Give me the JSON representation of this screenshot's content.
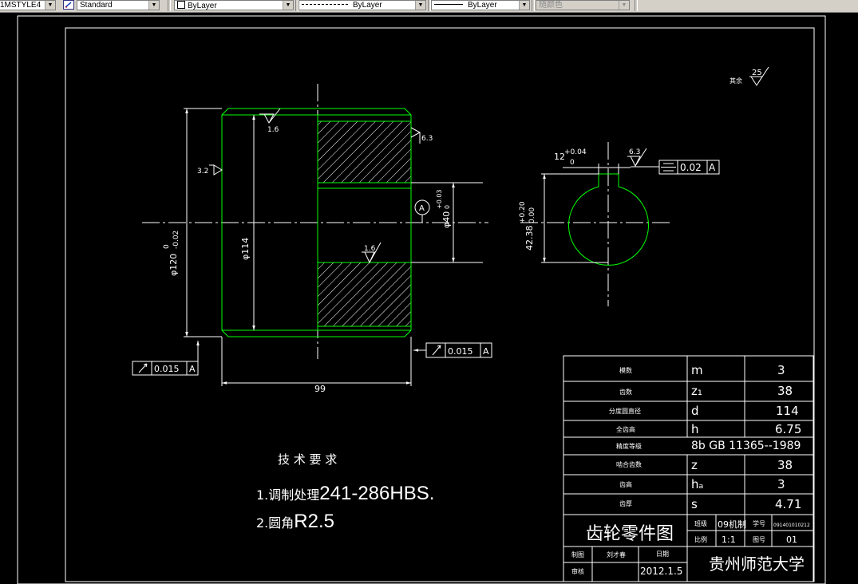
{
  "toolbar": {
    "style_combo": "1MSTYLE4",
    "text_style": "Standard",
    "layer": "ByLayer",
    "linetype": "ByLayer",
    "lineweight": "ByLayer",
    "color": "随颜色"
  },
  "drawing": {
    "colors": {
      "outline": "#ffffff",
      "part": "#00ff00",
      "hatch": "#ffffff"
    },
    "roughness": {
      "other": "其余",
      "other_value": "25",
      "r16_top": "1.6",
      "r63_right": "6.3",
      "r32_left": "3.2",
      "r16_mid": "1.6",
      "r63_key": "6.3"
    },
    "dims": {
      "d120": "φ120",
      "d120_tol_upper": "0",
      "d120_tol_lower": "-0.02",
      "d114": "φ114",
      "d40": "φ40",
      "d40_tol": "+0.03",
      "d40_tol_lower": "0",
      "len99": "99",
      "key_width": "12",
      "key_tol_upper": "+0.04",
      "key_tol_lower": "0",
      "key_depth": "42.38",
      "key_depth_tol_upper": "+0.20",
      "key_depth_tol_lower": "0.00"
    },
    "datum": "A",
    "tolerance_frames": [
      {
        "symbol": "runout",
        "value": "0.015",
        "datum": "A"
      },
      {
        "symbol": "runout",
        "value": "0.015",
        "datum": "A"
      },
      {
        "symbol": "symmetry",
        "value": "0.02",
        "datum": "A"
      }
    ],
    "notes": {
      "heading": "技 术 要 求",
      "line1_prefix": "1.调制处理",
      "line1_value": "241-286HBS.",
      "line2_prefix": "2.圆角",
      "line2_value": "R2.5"
    }
  },
  "param_table": [
    {
      "name": "模数",
      "symbol": "m",
      "value": "3"
    },
    {
      "name": "齿数",
      "symbol": "z₁",
      "value": "38"
    },
    {
      "name": "分度圆直径",
      "symbol": "d",
      "value": "114"
    },
    {
      "name": "全齿高",
      "symbol": "h",
      "value": "6.75"
    },
    {
      "name": "精度等级",
      "spec": "8b GB 11365--1989"
    },
    {
      "name": "啮合齿数",
      "symbol": "z",
      "value": "38"
    },
    {
      "name": "齿高",
      "symbol": "hₐ",
      "value": "3"
    },
    {
      "name": "齿厚",
      "symbol": "s",
      "value": "4.71"
    }
  ],
  "title_block": {
    "title": "齿轮零件图",
    "class_label": "班级",
    "class_value": "09机制",
    "student_no_label": "学号",
    "student_no_value": "091401010212",
    "scale_label": "比例",
    "scale_value": "1:1",
    "drawing_no_label": "图号",
    "drawing_no_value": "01",
    "drawn_label": "制图",
    "drawn_value": "刘才春",
    "date_label": "日期",
    "date_value": "2012.1.5",
    "check_label": "审核",
    "school": "贵州师范大学"
  }
}
